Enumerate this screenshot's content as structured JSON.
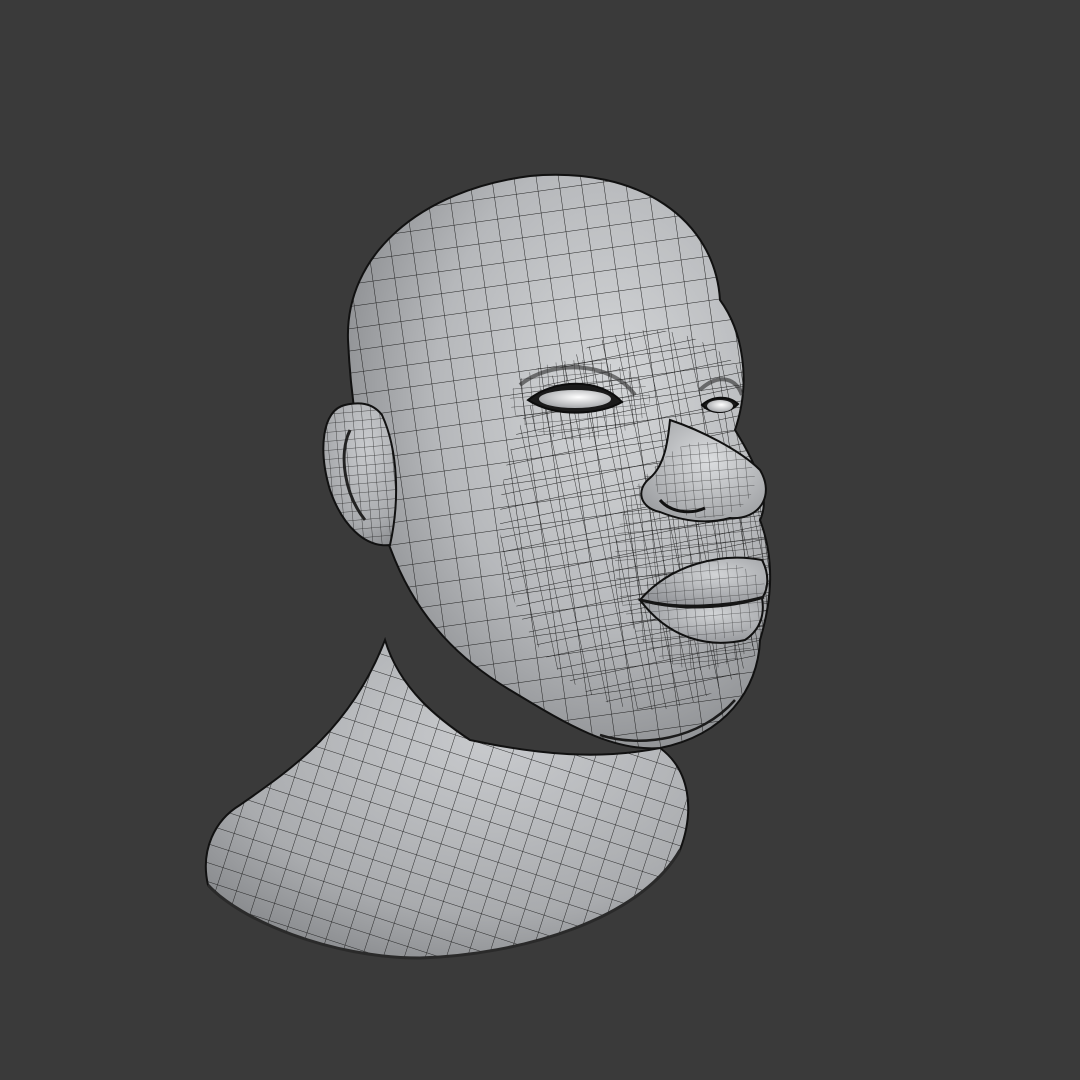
{
  "viewport": {
    "background_color": "#3a3a3a"
  },
  "model": {
    "subject": "head-bust",
    "shading": "solid-with-wireframe",
    "surface_color": "#b9bbbe",
    "wire_color": "#141414",
    "eye_color": "#f2f2f2"
  }
}
